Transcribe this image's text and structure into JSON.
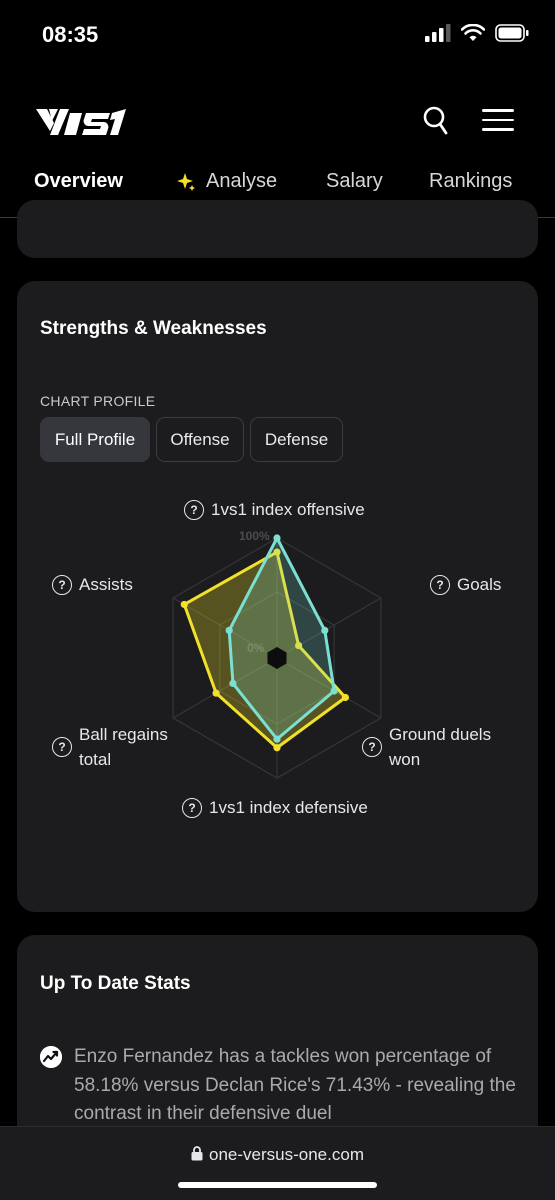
{
  "status": {
    "time": "08:35"
  },
  "header": {
    "logo": "1VS1"
  },
  "tabs": [
    {
      "label": "Overview",
      "active": true
    },
    {
      "label": "Analyse",
      "active": false
    },
    {
      "label": "Salary",
      "active": false
    },
    {
      "label": "Rankings",
      "active": false
    }
  ],
  "strengths": {
    "title": "Strengths & Weaknesses",
    "chart_profile_label": "CHART PROFILE",
    "profiles": [
      "Full Profile",
      "Offense",
      "Defense"
    ],
    "selected_profile": "Full Profile"
  },
  "chart_data": {
    "type": "radar",
    "axes": [
      "1vs1 index offensive",
      "Goals",
      "Ground duels won",
      "1vs1 index defensive",
      "Ball regains total",
      "Assists"
    ],
    "axis_labels": {
      "offensive": "1vs1 index offensive",
      "goals": "Goals",
      "ground_duels_1": "Ground duels",
      "ground_duels_2": "won",
      "defensive": "1vs1 index defensive",
      "ball_regains_1": "Ball regains",
      "ball_regains_2": "total",
      "assists": "Assists"
    },
    "scale_labels": {
      "max": "100%",
      "min": "0%"
    },
    "range": [
      0,
      100
    ],
    "series": [
      {
        "color": "#f2e12b",
        "values": [
          87,
          12,
          62,
          72,
          54,
          88
        ]
      },
      {
        "color": "#7be0d2",
        "values": [
          100,
          40,
          50,
          64,
          36,
          40
        ]
      }
    ]
  },
  "stats": {
    "title": "Up To Date Stats",
    "items": [
      {
        "text": "Enzo Fernandez has a tackles won percentage of 58.18% versus Declan Rice's 71.43% - revealing the contrast in their defensive duel"
      }
    ]
  },
  "browser": {
    "url": "one-versus-one.com"
  }
}
